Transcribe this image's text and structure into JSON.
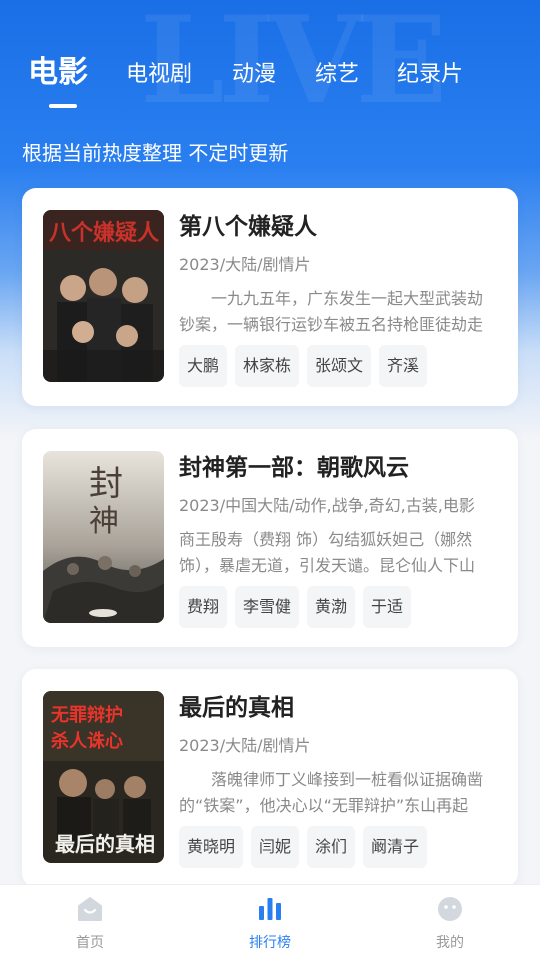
{
  "tabs": [
    {
      "label": "电影",
      "active": true
    },
    {
      "label": "电视剧",
      "active": false
    },
    {
      "label": "动漫",
      "active": false
    },
    {
      "label": "综艺",
      "active": false
    },
    {
      "label": "纪录片",
      "active": false
    }
  ],
  "subtitle": "根据当前热度整理 不定时更新",
  "movies": [
    {
      "title": "第八个嫌疑人",
      "meta": "2023/大陆/剧情片",
      "description": "　　一九九五年，广东发生一起大型武装劫钞案，一辆银行运钞车被五名持枪匪徒劫走",
      "tags": [
        "大鹏",
        "林家栋",
        "张颂文",
        "齐溪"
      ],
      "poster_icon": "poster-suspect"
    },
    {
      "title": "封神第一部：朝歌风云",
      "meta": "2023/中国大陆/动作,战争,奇幻,古装,电影",
      "description": "商王殷寿（费翔 饰）勾结狐妖妲己（娜然 饰），暴虐无道，引发天谴。昆仑仙人下山",
      "tags": [
        "费翔",
        "李雪健",
        "黄渤",
        "于适"
      ],
      "poster_icon": "poster-fengshen"
    },
    {
      "title": "最后的真相",
      "meta": "2023/大陆/剧情片",
      "description": "　　落魄律师丁义峰接到一桩看似证据确凿的“铁案”，他决心以“无罪辩护”东山再起",
      "tags": [
        "黄晓明",
        "闫妮",
        "涂们",
        "阚清子"
      ],
      "poster_icon": "poster-truth"
    }
  ],
  "bottom_nav": [
    {
      "label": "首页",
      "icon": "home-icon",
      "active": false
    },
    {
      "label": "排行榜",
      "icon": "ranking-icon",
      "active": true
    },
    {
      "label": "我的",
      "icon": "profile-icon",
      "active": false
    }
  ],
  "colors": {
    "accent": "#2a7ff0",
    "hero_top": "#1a6fe6",
    "background": "#f3f5f8",
    "tag_bg": "#f4f5f7",
    "inactive_nav": "#9a9a9a"
  }
}
